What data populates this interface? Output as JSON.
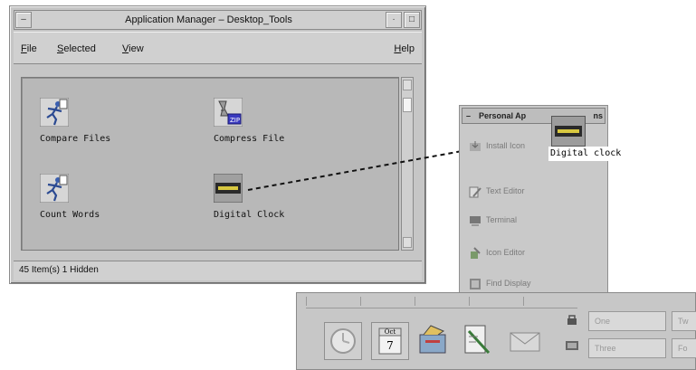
{
  "app_manager": {
    "title": "Application Manager – Desktop_Tools",
    "menu": {
      "file": {
        "mnemonic": "F",
        "rest": "ile"
      },
      "selected": {
        "mnemonic": "S",
        "rest": "elected"
      },
      "view": {
        "mnemonic": "V",
        "rest": "iew"
      },
      "help": {
        "mnemonic": "H",
        "rest": "elp"
      }
    },
    "apps": [
      {
        "label": "Compare Files",
        "icon": "runner-icon"
      },
      {
        "label": "Compress File",
        "icon": "compress-icon"
      },
      {
        "label": "Count Words",
        "icon": "runner-icon"
      },
      {
        "label": "Digital Clock",
        "icon": "digital-clock-icon"
      }
    ],
    "status": "45 Item(s) 1 Hidden"
  },
  "subpanel": {
    "title": "Personal Ap",
    "title_tail": "ns",
    "items": [
      {
        "label": "Install Icon",
        "icon": "install-icon"
      },
      {
        "label": "Text Editor",
        "icon": "text-editor-icon"
      },
      {
        "label": "Terminal",
        "icon": "terminal-icon"
      },
      {
        "label": "Icon Editor",
        "icon": "icon-editor-icon"
      },
      {
        "label": "Find Display",
        "icon": "find-display-icon"
      }
    ],
    "drag_label": "Digital clock"
  },
  "front_panel": {
    "calendar_month": "Oct",
    "calendar_day": "7",
    "workspaces": [
      "One",
      "Three",
      "Tw",
      "Fo"
    ]
  },
  "colors": {
    "window_bg": "#c6c6c6",
    "icon_pane": "#b8b8b8",
    "clock_face": "#2a2a2a",
    "clock_digits": "#d8c840"
  }
}
